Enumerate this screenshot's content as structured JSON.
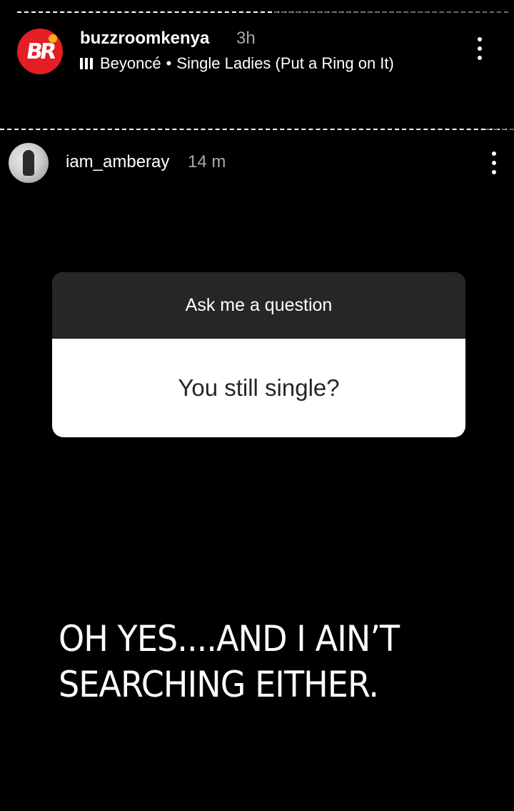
{
  "story_outer": {
    "username": "buzzroomkenya",
    "time": "3h",
    "music": {
      "icon": "music-bars-icon",
      "artist": "Beyoncé",
      "separator": "•",
      "song": "Single Ladies (Put a Ring on It)"
    },
    "logo_text": "BR",
    "logo_colors": {
      "circle": "#e31e24",
      "dot": "#f7b21c"
    }
  },
  "story_inner": {
    "username": "iam_amberay",
    "time": "14 m"
  },
  "question_sticker": {
    "header": "Ask me a question",
    "question": "You still single?"
  },
  "caption": {
    "line1": "OH YES....AND I AIN’T",
    "line2": "SEARCHING EITHER."
  },
  "icons": {
    "more_options": "kebab-menu-icon"
  }
}
